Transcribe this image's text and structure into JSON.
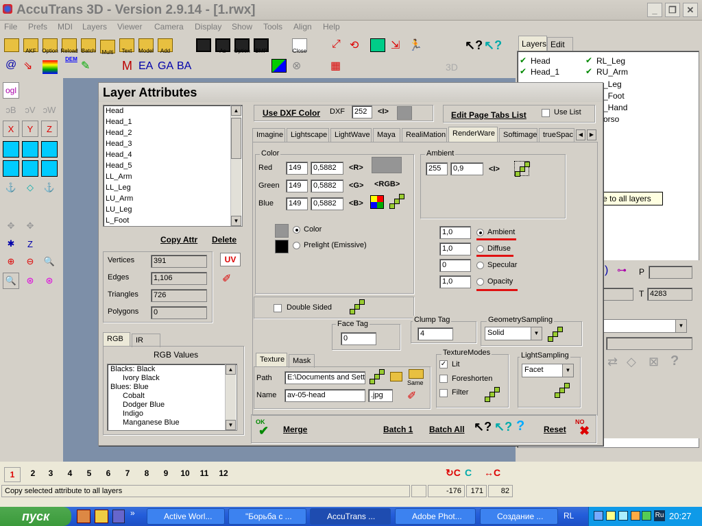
{
  "app": {
    "title": "AccuTrans 3D - Version 2.9.14 - [1.rwx]",
    "menu": [
      "File",
      "Prefs",
      "MDI",
      "Layers",
      "Viewer",
      "Camera",
      "Display",
      "Show",
      "Tools",
      "Align",
      "Help"
    ],
    "toolbar_labels": [
      "AKF",
      "Option",
      "Reload",
      "Batch",
      "Multi",
      "Text",
      "Model",
      "Add",
      "As",
      "Option",
      "BMP",
      "Close"
    ],
    "toolbar_text_icons": [
      "EA",
      "GA",
      "BA",
      "DEM"
    ]
  },
  "left_panel": {
    "ogl_label": "ogl"
  },
  "right_panel": {
    "tabs": [
      "Layers",
      "Edit"
    ],
    "layers": [
      "Head",
      "Head_1",
      "RL_Leg",
      "RU_Arm",
      "_Leg",
      "_Foot",
      "_Hand",
      "orso"
    ],
    "p_label": "P",
    "t_label": "T",
    "t_value": "4283",
    "small_value": "3"
  },
  "tooltip": "Copy selected attribute to all layers",
  "dialog": {
    "title": "Layer Attributes",
    "layer_list": [
      "Head",
      "Head_1",
      "Head_2",
      "Head_3",
      "Head_4",
      "Head_5",
      "LL_Arm",
      "LL_Leg",
      "LU_Arm",
      "LU_Leg",
      "L_Foot"
    ],
    "copy_attr": "Copy Attr",
    "delete": "Delete",
    "stats": {
      "vertices_label": "Vertices",
      "vertices": "391",
      "edges_label": "Edges",
      "edges": "1,106",
      "triangles_label": "Triangles",
      "triangles": "726",
      "polygons_label": "Polygons",
      "polygons": "0"
    },
    "uv_label": "UV",
    "rgb_tabs": [
      "RGB",
      "IR"
    ],
    "rgb_values_title": "RGB Values",
    "rgb_list": [
      "Blacks: Black",
      "Ivory Black",
      "Blues: Blue",
      "Cobalt",
      "Dodger Blue",
      "Indigo",
      "Manganese Blue"
    ],
    "use_dxf_color": "Use DXF Color",
    "dxf_label": "DXF",
    "dxf_value": "252",
    "dxf_arrow": "<I>",
    "edit_page_tabs": "Edit Page Tabs List",
    "use_list": "Use List",
    "tabs": [
      "Imagine",
      "Lightscape",
      "LightWave",
      "Maya",
      "RealiMation",
      "RenderWare",
      "Softimage",
      "trueSpac"
    ],
    "color": {
      "label": "Color",
      "red_label": "Red",
      "red": "149",
      "red_f": "0,5882",
      "red_btn": "<R>",
      "green_label": "Green",
      "green": "149",
      "green_f": "0,5882",
      "green_btn": "<G>",
      "blue_label": "Blue",
      "blue": "149",
      "blue_f": "0,5882",
      "blue_btn": "<B>",
      "rgb_btn": "<RGB>",
      "swatch": "#959595",
      "opt_color": "Color",
      "opt_prelight": "Prelight (Emissive)"
    },
    "ambient": {
      "label": "Ambient",
      "value": "255",
      "float": "0,9",
      "btn": "<I>"
    },
    "coefs": [
      {
        "value": "1,0",
        "label": "Ambient",
        "selected": true
      },
      {
        "value": "1,0",
        "label": "Diffuse",
        "selected": false
      },
      {
        "value": "0",
        "label": "Specular",
        "selected": false
      },
      {
        "value": "1,0",
        "label": "Opacity",
        "selected": false
      }
    ],
    "double_sided": "Double Sided",
    "face_tag": {
      "label": "Face Tag",
      "value": "0"
    },
    "clump_tag": {
      "label": "Clump Tag",
      "value": "4"
    },
    "geometry_sampling": {
      "label": "GeometrySampling",
      "value": "Solid"
    },
    "texture_tabs": [
      "Texture",
      "Mask"
    ],
    "path_label": "Path",
    "path_value": "E:\\Documents and Sett",
    "name_label": "Name",
    "name_value": "av-05-head",
    "ext_value": ".jpg",
    "same_label": "Same",
    "texture_modes": {
      "label": "TextureModes",
      "lit": "Lit",
      "foreshorten": "Foreshorten",
      "filter": "Filter"
    },
    "light_sampling": {
      "label": "LightSampling",
      "value": "Facet"
    },
    "ok_label": "OK",
    "merge": "Merge",
    "batch1": "Batch 1",
    "batch_all": "Batch All",
    "reset": "Reset",
    "no_label": "NO"
  },
  "statusbar": {
    "pages": [
      "1",
      "2",
      "3",
      "4",
      "5",
      "6",
      "7",
      "8",
      "9",
      "10",
      "11",
      "12"
    ],
    "message": "Copy selected attribute to all layers",
    "coords": [
      "-176",
      "171",
      "82"
    ]
  },
  "taskbar": {
    "start": "пуск",
    "tasks": [
      "Active Worl...",
      "\"Борьба с ...",
      "AccuTrans ...",
      "Adobe Phot...",
      "Создание ..."
    ],
    "lang": "RL",
    "tray_lang": "Ru",
    "time": "20:27"
  }
}
